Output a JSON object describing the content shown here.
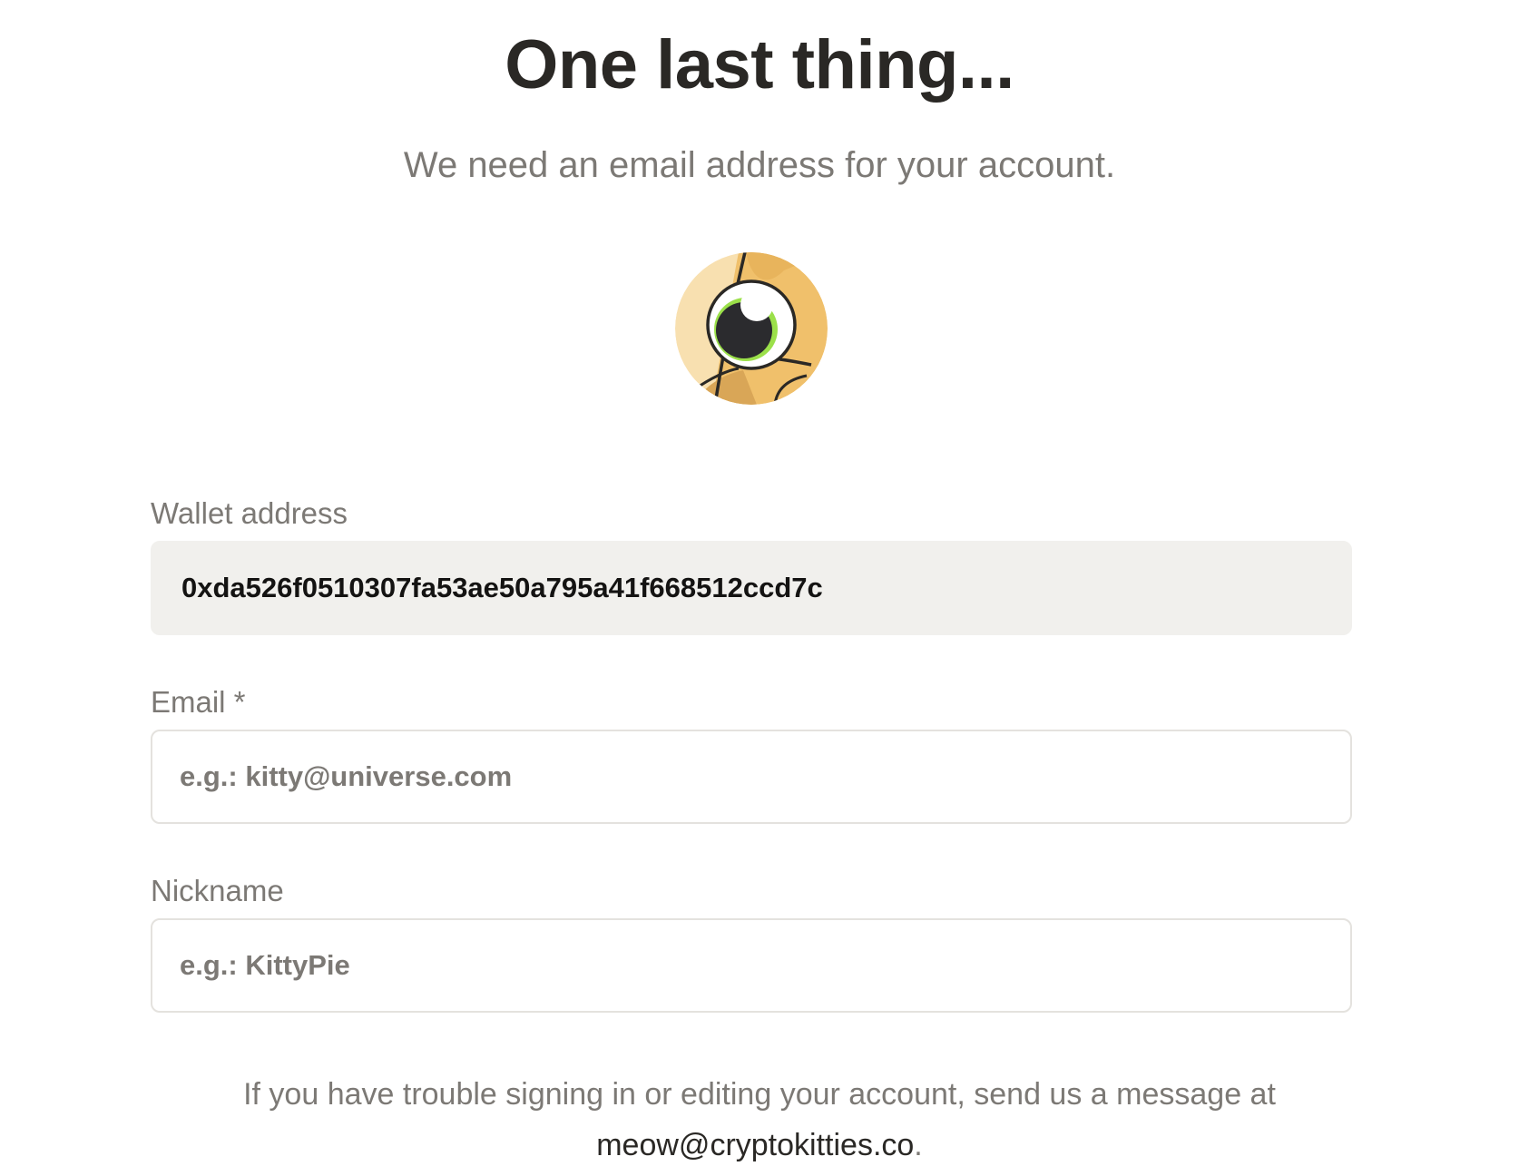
{
  "header": {
    "title": "One last thing...",
    "subtitle": "We need an email address for your account."
  },
  "avatar": {
    "icon": "kitty-eye-avatar-icon",
    "colors": {
      "fur": "#f0c06b",
      "fur_light": "#f8e0b0",
      "eye_iris": "#2b2b2e",
      "eye_ring": "#9be04a",
      "outline": "#2a2825"
    }
  },
  "form": {
    "wallet": {
      "label": "Wallet address",
      "value": "0xda526f0510307fa53ae50a795a41f668512ccd7c"
    },
    "email": {
      "label": "Email *",
      "placeholder": "e.g.: kitty@universe.com",
      "value": ""
    },
    "nickname": {
      "label": "Nickname",
      "placeholder": "e.g.: KittyPie",
      "value": ""
    }
  },
  "footer": {
    "text": "If you have trouble signing in or editing your account, send us a message at",
    "email": "meow@cryptokitties.co",
    "period": "."
  },
  "colors": {
    "title": "#2a2825",
    "muted_text": "#7c7975",
    "readonly_bg": "#f1f0ed",
    "input_border": "#e4e2de"
  }
}
